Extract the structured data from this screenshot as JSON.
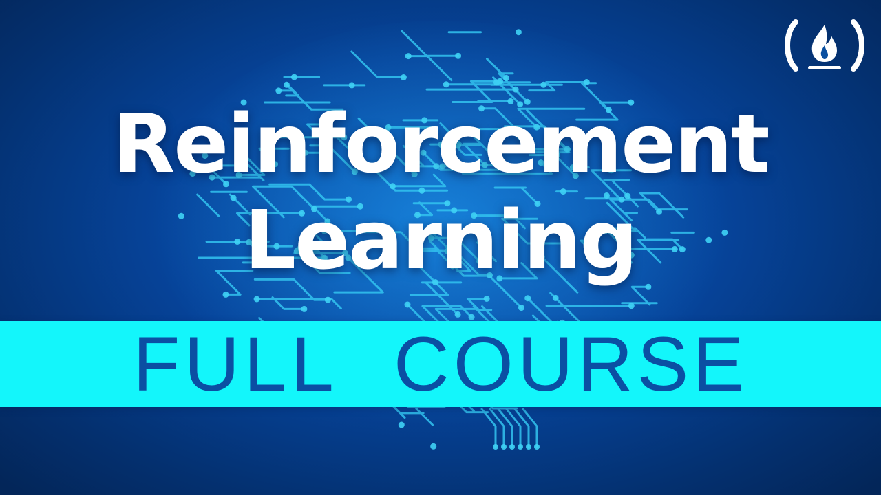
{
  "thumbnail": {
    "title_line_1": "Reinforcement",
    "title_line_2": "Learning",
    "banner_text": "FULL COURSE"
  },
  "logo": {
    "icon": "freecodecamp-logo-icon"
  },
  "colors": {
    "background_center": "#0a62c4",
    "background_edge": "#032659",
    "circuit_line": "#33c4f0",
    "banner_background": "#13f6fb",
    "banner_text": "#0b4fa3",
    "title_text": "#ffffff"
  }
}
